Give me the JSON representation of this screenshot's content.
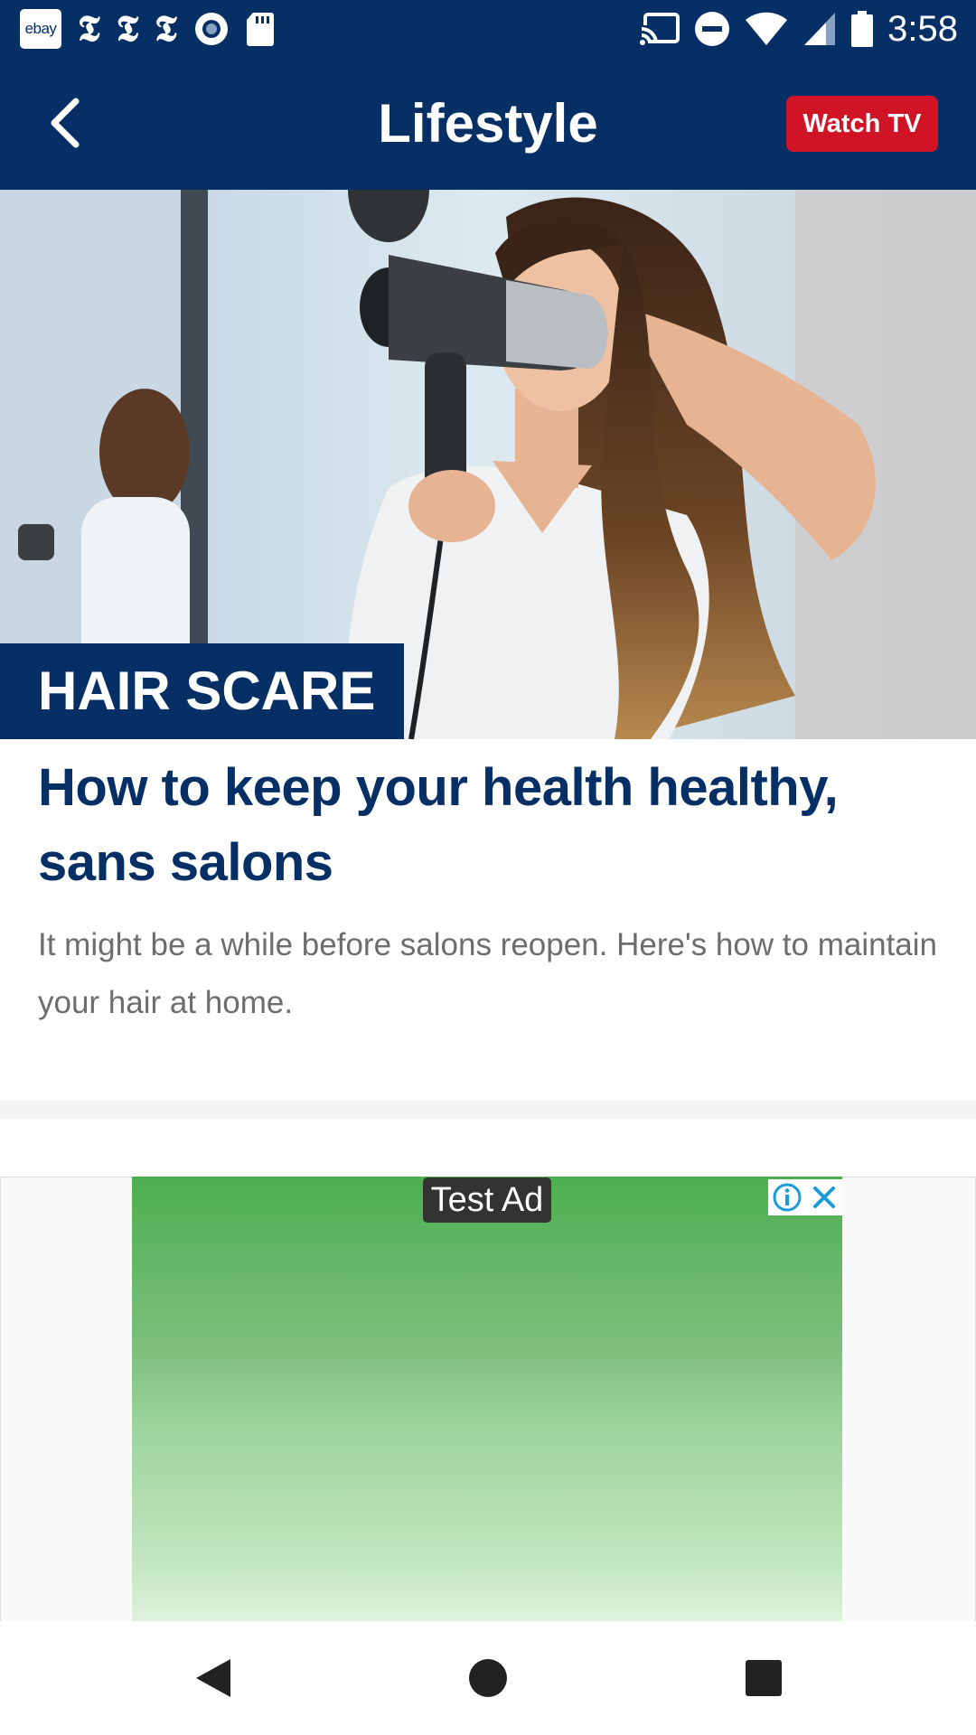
{
  "status_bar": {
    "notification_icons": [
      "ebay-icon",
      "nyt-icon",
      "nyt-icon",
      "nyt-icon",
      "record-icon",
      "sd-card-icon"
    ],
    "ebay_label": "ebay",
    "nyt_glyph": "𝕿",
    "system_icons": [
      "cast-icon",
      "do-not-disturb-icon",
      "wifi-icon",
      "cellular-signal-icon",
      "battery-icon"
    ],
    "time": "3:58"
  },
  "app_bar": {
    "title": "Lifestyle",
    "watch_tv_label": "Watch TV",
    "colors": {
      "background": "#062f66",
      "button": "#d11425"
    }
  },
  "hero": {
    "image": "woman-drying-hair-photo",
    "tag": "HAIR SCARE"
  },
  "article": {
    "headline": "How to keep your health healthy, sans salons",
    "summary": "It might be a while before salons reopen. Here's how to maintain your hair at home."
  },
  "ad": {
    "label": "Test Ad",
    "icons": [
      "info-icon",
      "close-icon"
    ]
  },
  "nav_bar": {
    "buttons": [
      "back-triangle-icon",
      "home-circle-icon",
      "recents-square-icon"
    ]
  }
}
